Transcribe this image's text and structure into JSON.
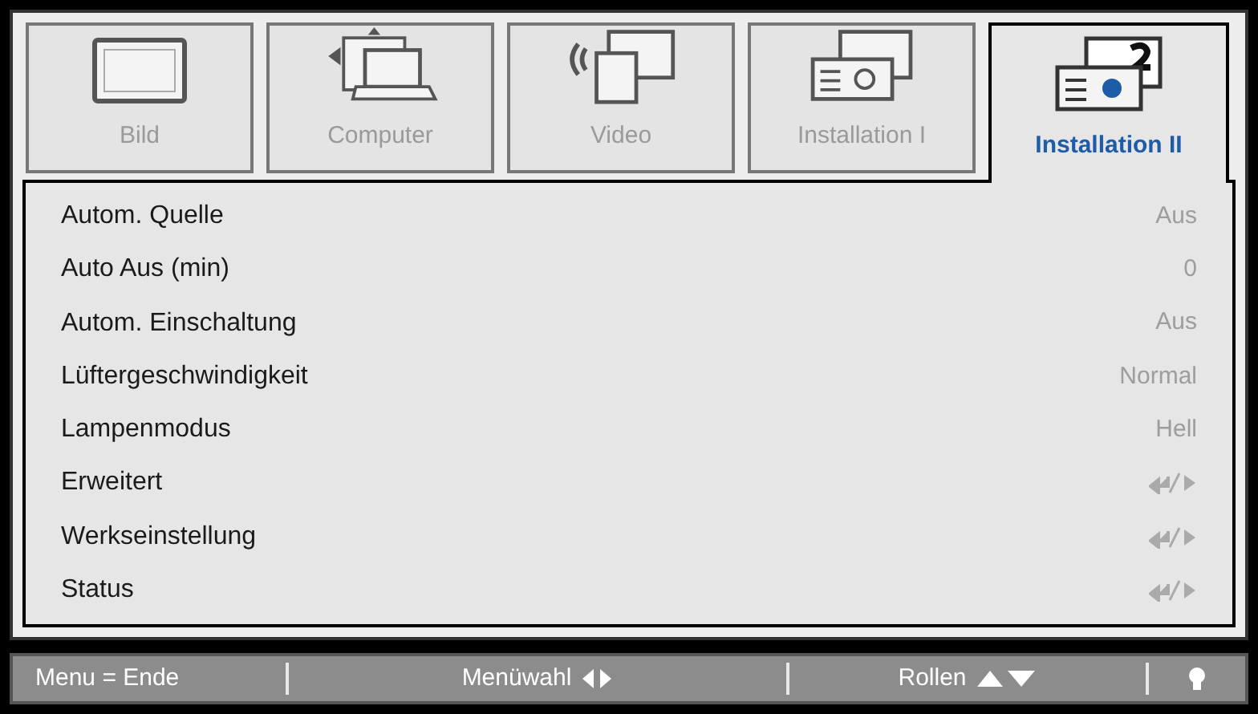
{
  "tabs": [
    {
      "label": "Bild",
      "selected": false
    },
    {
      "label": "Computer",
      "selected": false
    },
    {
      "label": "Video",
      "selected": false
    },
    {
      "label": "Installation I",
      "selected": false
    },
    {
      "label": "Installation II",
      "selected": true
    }
  ],
  "settings": [
    {
      "label": "Autom. Quelle",
      "kind": "value",
      "value": "Aus"
    },
    {
      "label": "Auto Aus (min)",
      "kind": "value",
      "value": "0"
    },
    {
      "label": "Autom. Einschaltung",
      "kind": "value",
      "value": "Aus"
    },
    {
      "label": "Lüftergeschwindigkeit",
      "kind": "value",
      "value": "Normal"
    },
    {
      "label": "Lampenmodus",
      "kind": "value",
      "value": "Hell"
    },
    {
      "label": "Erweitert",
      "kind": "submenu"
    },
    {
      "label": "Werkseinstellung",
      "kind": "submenu"
    },
    {
      "label": "Status",
      "kind": "submenu"
    }
  ],
  "status_bar": {
    "exit": "Menu = Ende",
    "select": "Menüwahl",
    "scroll": "Rollen"
  }
}
